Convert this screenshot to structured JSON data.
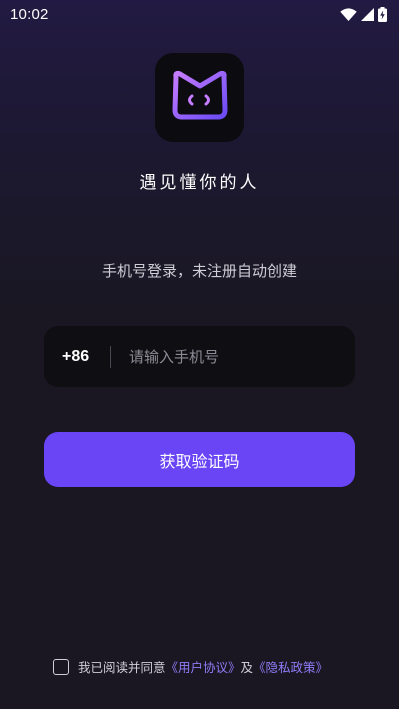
{
  "status_bar": {
    "time": "10:02",
    "icons": [
      "wifi-icon",
      "cell-signal-icon",
      "battery-charging-icon"
    ]
  },
  "logo": {
    "icon": "cat-face-logo-icon",
    "accent_colors": [
      "#6a4af6",
      "#c77dff"
    ]
  },
  "slogan": "遇见懂你的人",
  "login_hint": "手机号登录，未注册自动创建",
  "phone_field": {
    "country_code": "+86",
    "value": "",
    "placeholder": "请输入手机号"
  },
  "get_code_button": {
    "label": "获取验证码",
    "color": "#6a45f6"
  },
  "agreement": {
    "checked": false,
    "prefix": "我已阅读并同意",
    "user_agreement": "《用户协议》",
    "and": "及",
    "privacy_policy": "《隐私政策》",
    "link_color": "#8f7cf7"
  }
}
